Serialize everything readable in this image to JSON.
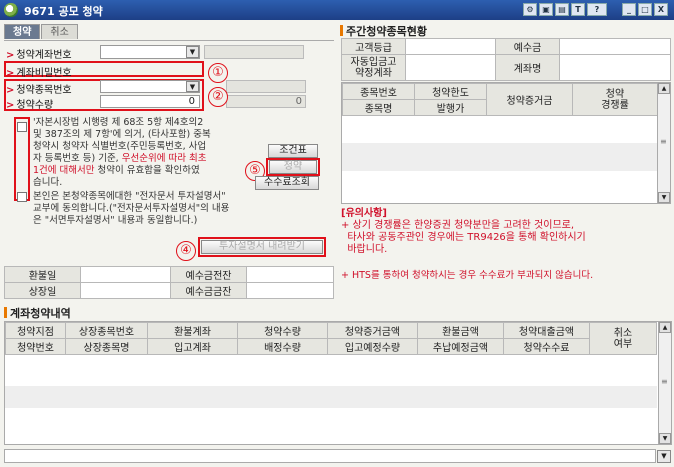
{
  "window": {
    "title": "9671 공모 청약",
    "icons": [
      "settings-icon",
      "image-icon",
      "print-icon",
      "text-icon",
      "help-icon",
      "minimize-icon",
      "maximize-icon",
      "close-icon"
    ],
    "control_labels": [
      "_",
      "□",
      "X"
    ],
    "top_button_glyphs": [
      "⚙",
      "▣",
      "▤",
      "T",
      "?"
    ]
  },
  "tabs": [
    {
      "label": "청약",
      "active": true
    },
    {
      "label": "취소",
      "active": false
    }
  ],
  "form": {
    "account_label": "청약계좌번호",
    "password_label": "계좌비밀번호",
    "item_label": "청약종목번호",
    "qty_label": "청약수량",
    "qty_value": "0",
    "side_value": "0",
    "dropdown_glyph": "▼",
    "arrow_glyph": ">"
  },
  "annotations": {
    "c1": "①",
    "c2": "②",
    "c4": "④",
    "c5": "⑤"
  },
  "agreements": {
    "text1_lines": [
      "'자본시장법 시행령 제 68조 5항 제4호의2",
      "및 387조의 제 7항'에 의거, (타사포함) 중복",
      "청약시 청약자 식별번호(주민등록번호, 사업",
      "자 등록번호 등) 기준, "
    ],
    "text1_red_a": "우선순위에 따라 최초",
    "text1_red_b": "1건에 대해서만",
    "text1_tail_a": " 청약이 유효함을 확인하였",
    "text1_tail_b": "습니다.",
    "text2_lines": [
      "본인은 본청약종목에대한 \"전자문서 투자설명서\"",
      "교부에 동의합니다.(\"전자문서투자설명서\"의 내용",
      "은 \"서면투자설명서\" 내용과 동일합니다.)"
    ]
  },
  "buttons": {
    "conditions": "조건표",
    "subscribe": "청약",
    "fee_query": "수수료조회",
    "download": "투자설명서 내려받기"
  },
  "dates": {
    "refund_label": "환불일",
    "listing_label": "상장일",
    "deposit_before_label": "예수금전잔",
    "deposit_after_label": "예수금금잔"
  },
  "major_items": {
    "title": "주간청약종목현황",
    "customer_grade_label": "고객등급",
    "deposit_label": "예수금",
    "auto_transfer_label_1": "자동입금고",
    "auto_transfer_label_2": "약정계좌",
    "account_name_label": "계좌명",
    "grid_headers": [
      "종목번호",
      "청약한도",
      "청약증거금",
      "청약",
      "종목명",
      "발행가",
      "경쟁률"
    ]
  },
  "notice": {
    "title": "[유의사항]",
    "items": [
      "+ 상기 경쟁률은 한양증권 청약분만을 고려한 것이므로,",
      "  타사와 공동주관인 경우에는 TR9426을 통해 확인하시기",
      "  바랍니다."
    ],
    "fee_notice": "+ HTS를 통하여 청약하시는 경우 수수료가 부과되지 않습니다."
  },
  "history": {
    "title": "계좌청약내역",
    "row1": [
      "청약지점",
      "상장종목번호",
      "환불계좌",
      "청약수량",
      "청약증거금액",
      "환불금액",
      "청약대출금액"
    ],
    "row2": [
      "청약번호",
      "상장종목명",
      "입고계좌",
      "배정수량",
      "입고예정수량",
      "추납예정금액",
      "청약수수료"
    ],
    "cancel_1": "취소",
    "cancel_2": "여부"
  },
  "scroll": {
    "up": "▲",
    "down": "▼",
    "grip": "≡"
  }
}
